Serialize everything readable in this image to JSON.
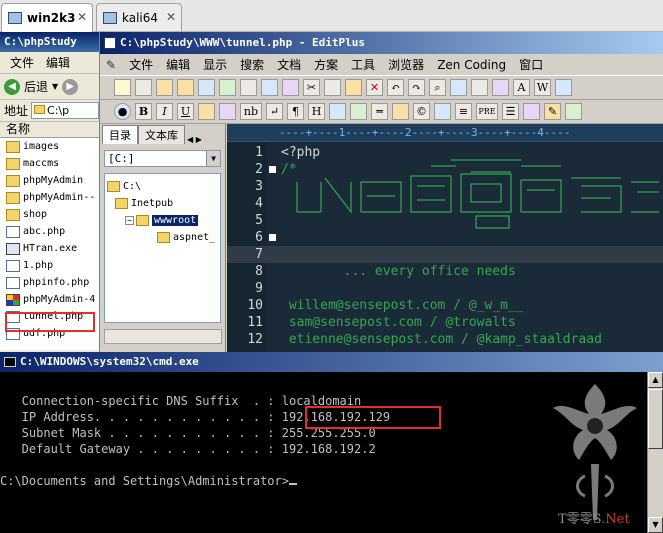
{
  "vm_tabs": [
    {
      "label": "win2k3",
      "active": true
    },
    {
      "label": "kali64",
      "active": false
    }
  ],
  "explorer": {
    "title": "C:\\phpStudy",
    "menu": [
      "文件",
      "编辑"
    ],
    "back_label": "后退",
    "address_label": "地址",
    "address_value": "C:\\p",
    "column_header": "名称",
    "files": [
      {
        "name": "images",
        "icon": "folder-icon"
      },
      {
        "name": "maccms",
        "icon": "folder-icon"
      },
      {
        "name": "phpMyAdmin",
        "icon": "folder-icon"
      },
      {
        "name": "phpMyAdmin--",
        "icon": "folder-icon"
      },
      {
        "name": "shop",
        "icon": "folder-icon"
      },
      {
        "name": "abc.php",
        "icon": "php-file-icon"
      },
      {
        "name": "HTran.exe",
        "icon": "exe-file-icon"
      },
      {
        "name": "1.php",
        "icon": "php-file-icon"
      },
      {
        "name": "phpinfo.php",
        "icon": "php-file-icon"
      },
      {
        "name": "phpMyAdmin-4",
        "icon": "archive-icon"
      },
      {
        "name": "tunnel.php",
        "icon": "php-file-icon",
        "highlighted": true
      },
      {
        "name": "udf.php",
        "icon": "php-file-icon"
      }
    ]
  },
  "editplus": {
    "title": "C:\\phpStudy\\WWW\\tunnel.php - EditPlus",
    "menu": [
      "文件",
      "编辑",
      "显示",
      "搜索",
      "文档",
      "方案",
      "工具",
      "浏览器",
      "Zen Coding",
      "窗口"
    ],
    "toolbar2": [
      "B",
      "I",
      "U",
      "nb",
      "¶",
      "H",
      "PRE"
    ],
    "dir_tabs": [
      "目录",
      "文本库"
    ],
    "drive": "[C:]",
    "tree": [
      {
        "label": "C:\\",
        "depth": 0
      },
      {
        "label": "Inetpub",
        "depth": 1
      },
      {
        "label": "wwwroot",
        "depth": 2,
        "selected": true
      },
      {
        "label": "aspnet_",
        "depth": 3
      }
    ],
    "ruler": "----+----1----+----2----+----3----+----4----",
    "lines": [
      {
        "num": "1",
        "text": "<?php",
        "fold": false
      },
      {
        "num": "2",
        "text": "/*",
        "fold": true
      },
      {
        "num": "3",
        "text": "",
        "fold": false
      },
      {
        "num": "4",
        "text": "",
        "fold": false
      },
      {
        "num": "5",
        "text": "",
        "fold": false
      },
      {
        "num": "6",
        "text": "",
        "fold": true
      },
      {
        "num": "7",
        "text": "",
        "fold": false
      },
      {
        "num": "8",
        "text": "        ... every office needs",
        "fold": false
      },
      {
        "num": "9",
        "text": "",
        "fold": false
      },
      {
        "num": "10",
        "text": " willem@sensepost.com / @_w_m__",
        "fold": false
      },
      {
        "num": "11",
        "text": " sam@sensepost.com / @trowalts",
        "fold": false
      },
      {
        "num": "12",
        "text": " etienne@sensepost.com / @kamp_staaldraad",
        "fold": false
      }
    ]
  },
  "cmd": {
    "title": "C:\\WINDOWS\\system32\\cmd.exe",
    "lines": [
      "   Connection-specific DNS Suffix  . : localdomain",
      "   IP Address. . . . . . . . . . . . : 192.168.192.129",
      "   Subnet Mask . . . . . . . . . . . : 255.255.255.0",
      "   Default Gateway . . . . . . . . . : 192.168.192.2",
      "",
      "C:\\Documents and Settings\\Administrator>"
    ],
    "highlighted_value": "192.168.192.129"
  },
  "watermark": {
    "text": "T零零S",
    "suffix": ".Net"
  },
  "colors": {
    "highlight_box": "#e0302a",
    "editor_bg": "#1b2a38",
    "comment": "#2fa84f"
  }
}
